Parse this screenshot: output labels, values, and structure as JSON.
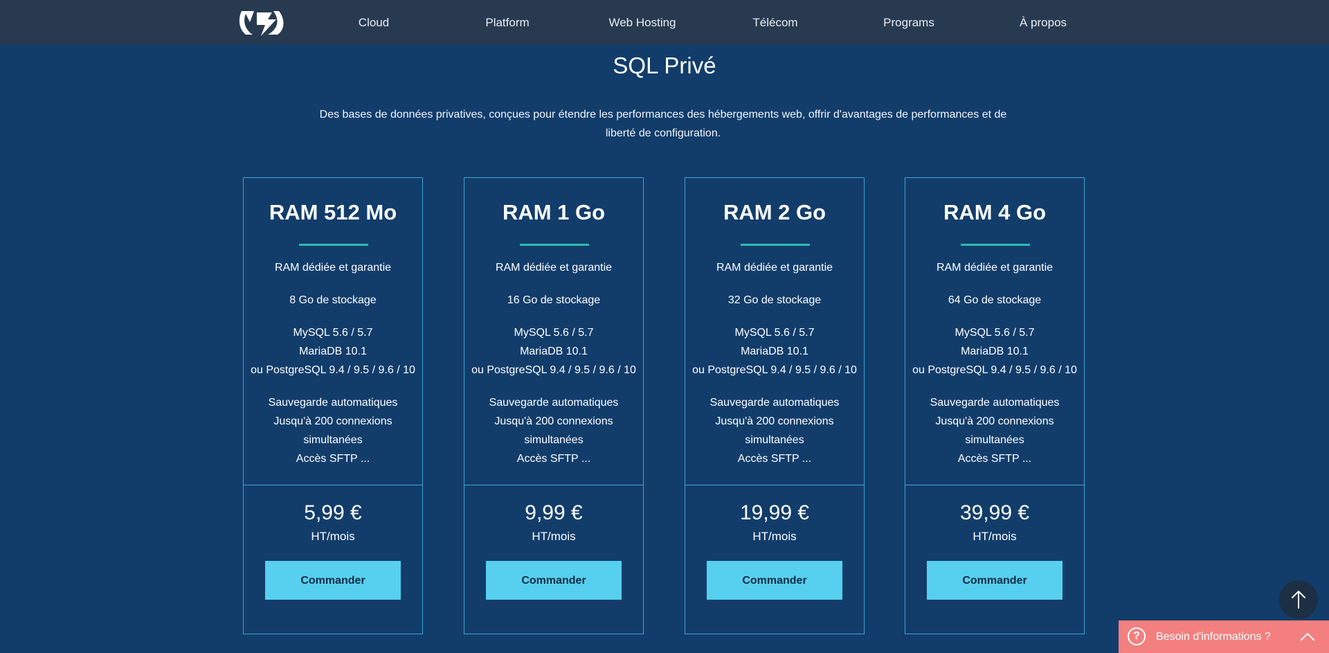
{
  "header": {
    "logo_alt": "OVH",
    "nav": [
      "Cloud",
      "Platform",
      "Web Hosting",
      "Télécom",
      "Programs",
      "À propos"
    ]
  },
  "section": {
    "title": "SQL Privé",
    "description": "Des bases de données privatives, conçues pour étendre les performances des hébergements web, offrir d'avantages de performances et de liberté de configuration."
  },
  "plans": [
    {
      "title": "RAM 512 Mo",
      "feature_groups": [
        [
          "RAM dédiée et garantie"
        ],
        [
          "8 Go de stockage"
        ],
        [
          "MySQL 5.6 / 5.7",
          "MariaDB 10.1",
          "ou PostgreSQL 9.4 / 9.5 / 9.6 / 10"
        ],
        [
          "Sauvegarde automatiques",
          "Jusqu'à 200 connexions",
          "simultanées",
          "Accès SFTP ..."
        ]
      ],
      "price": "5,99 €",
      "unit": "HT/mois",
      "button": "Commander"
    },
    {
      "title": "RAM 1 Go",
      "feature_groups": [
        [
          "RAM dédiée et garantie"
        ],
        [
          "16 Go de stockage"
        ],
        [
          "MySQL 5.6 / 5.7",
          "MariaDB 10.1",
          "ou PostgreSQL 9.4 / 9.5 / 9.6 / 10"
        ],
        [
          "Sauvegarde automatiques",
          "Jusqu'à 200 connexions",
          "simultanées",
          "Accès SFTP ..."
        ]
      ],
      "price": "9,99 €",
      "unit": "HT/mois",
      "button": "Commander"
    },
    {
      "title": "RAM 2 Go",
      "feature_groups": [
        [
          "RAM dédiée et garantie"
        ],
        [
          "32 Go de stockage"
        ],
        [
          "MySQL 5.6 / 5.7",
          "MariaDB 10.1",
          "ou PostgreSQL 9.4 / 9.5 / 9.6 / 10"
        ],
        [
          "Sauvegarde automatiques",
          "Jusqu'à 200 connexions",
          "simultanées",
          "Accès SFTP ..."
        ]
      ],
      "price": "19,99 €",
      "unit": "HT/mois",
      "button": "Commander"
    },
    {
      "title": "RAM 4 Go",
      "feature_groups": [
        [
          "RAM dédiée et garantie"
        ],
        [
          "64 Go de stockage"
        ],
        [
          "MySQL 5.6 / 5.7",
          "MariaDB 10.1",
          "ou PostgreSQL 9.4 / 9.5 / 9.6 / 10"
        ],
        [
          "Sauvegarde automatiques",
          "Jusqu'à 200 connexions",
          "simultanées",
          "Accès SFTP ..."
        ]
      ],
      "price": "39,99 €",
      "unit": "HT/mois",
      "button": "Commander"
    }
  ],
  "help": {
    "label": "Besoin d'informations ?",
    "icon": "question-icon"
  },
  "scroll_top_icon": "arrow-up-icon",
  "colors": {
    "background": "#123d6b",
    "header": "#283a50",
    "card_border": "#3ea3d6",
    "accent_underline": "#2bbcae",
    "button": "#56d0ee",
    "help_bar": "#f47f7f"
  }
}
